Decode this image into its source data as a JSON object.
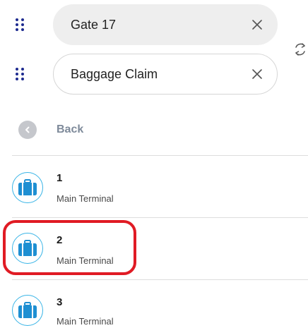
{
  "route": {
    "from": {
      "value": "Gate 17",
      "clear_icon": "close-icon",
      "drag_icon": "drag-handle-icon"
    },
    "to": {
      "value": "Baggage Claim",
      "clear_icon": "close-icon",
      "drag_icon": "drag-handle-icon"
    },
    "swap_icon": "swap-icon"
  },
  "back": {
    "label": "Back",
    "icon": "chevron-left-icon"
  },
  "results": [
    {
      "title": "1",
      "subtitle": "Main Terminal",
      "icon": "suitcase-icon"
    },
    {
      "title": "2",
      "subtitle": "Main Terminal",
      "icon": "suitcase-icon",
      "highlighted": true
    },
    {
      "title": "3",
      "subtitle": "Main Terminal",
      "icon": "suitcase-icon"
    }
  ],
  "colors": {
    "accent": "#1d2a8f",
    "icon_blue": "#1e8fd2",
    "highlight": "#e01b24",
    "back_text": "#7e8a9a"
  }
}
